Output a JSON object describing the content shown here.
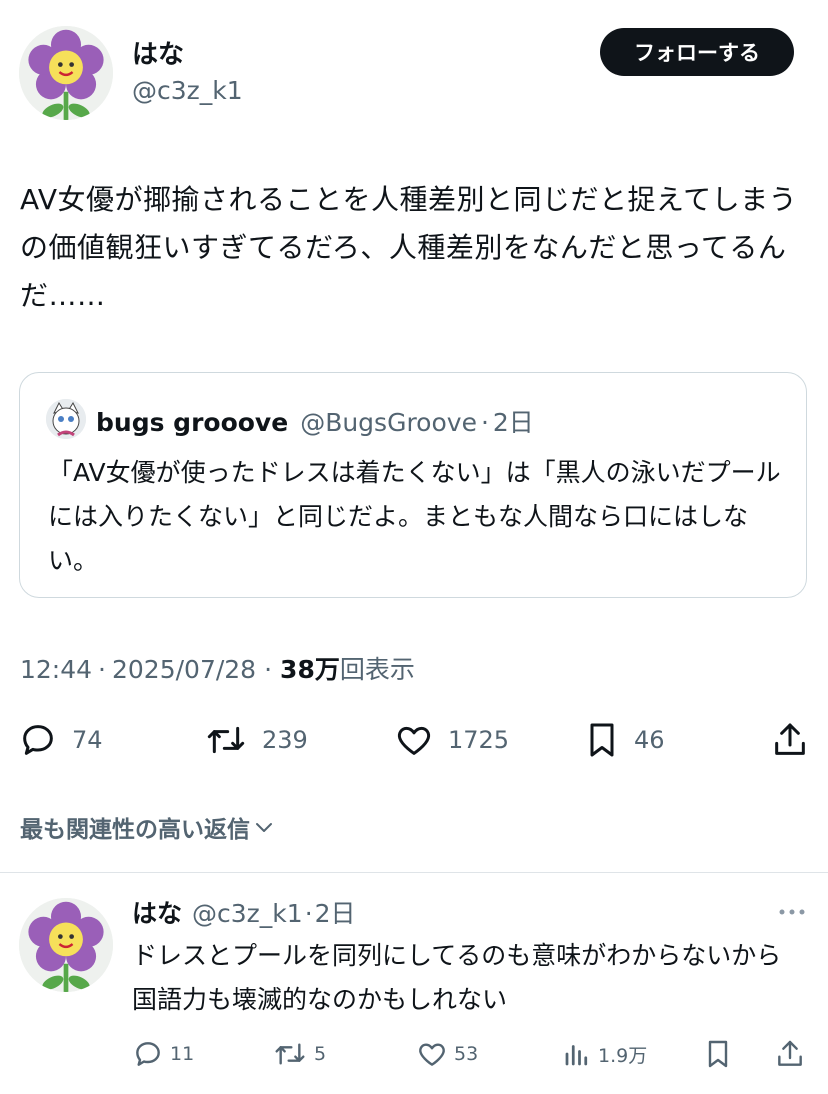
{
  "author": {
    "display_name": "はな",
    "handle": "@c3z_k1",
    "avatar_icon": "purple-flower-smiley-avatar"
  },
  "follow_button": {
    "label": "フォローする"
  },
  "tweet": {
    "text": "AV女優が揶揄されることを人種差別と同じだと捉えてしまうの価値観狂いすぎてるだろ、人種差別をなんだと思ってるんだ……"
  },
  "quote": {
    "display_name": "bugs grooove",
    "handle": "@BugsGroove",
    "separator": "·",
    "time": "2日",
    "text": "「AV女優が使ったドレスは着たくない」は「黒人の泳いだプールには入りたくない」と同じだよ。まともな人間なら口にはしない。"
  },
  "meta": {
    "time": "12:44",
    "dot1": "·",
    "date": "2025/07/28",
    "dot2": "·",
    "views": "38万",
    "views_label": "回表示"
  },
  "actions": {
    "replies": "74",
    "retweets": "239",
    "likes": "1725",
    "bookmarks": "46"
  },
  "sort": {
    "label": "最も関連性の高い返信"
  },
  "reply": {
    "display_name": "はな",
    "handle": "@c3z_k1",
    "separator": "·",
    "time": "2日",
    "text": "ドレスとプールを同列にしてるのも意味がわからないから国語力も壊滅的なのかもしれない",
    "replies": "11",
    "retweets": "5",
    "likes": "53",
    "views": "1.9万"
  },
  "colors": {
    "text": "#0f1419",
    "muted": "#536471",
    "border": "#cfd9de",
    "button_bg": "#0f1419"
  }
}
